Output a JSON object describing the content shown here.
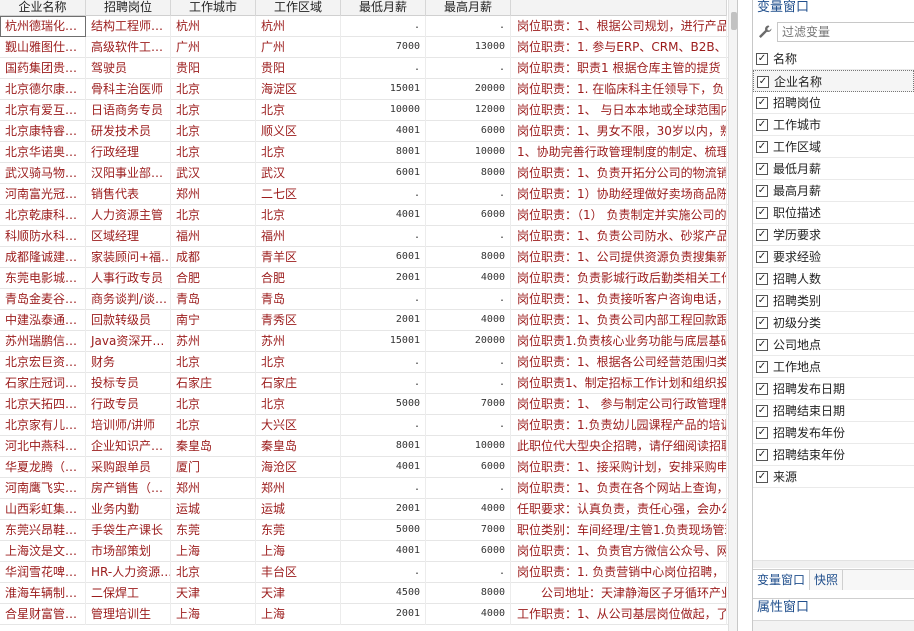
{
  "grid": {
    "columns": [
      "企业名称",
      "招聘岗位",
      "工作城市",
      "工作区域",
      "最低月薪",
      "最高月薪",
      ""
    ],
    "rows": [
      [
        "杭州德瑞化…",
        "结构工程师…",
        "杭州",
        "杭州",
        ".",
        ".",
        "岗位职责：1、根据公司规划，进行产品"
      ],
      [
        "觐山雅图仕…",
        "高级软件工…",
        "广州",
        "广州",
        "7000",
        "13000",
        "岗位职责：1. 参与ERP、CRM、B2B、BI、"
      ],
      [
        "国药集团贵…",
        "驾驶员",
        "贵阳",
        "贵阳",
        ".",
        ".",
        "岗位职责：职责1 根据仓库主管的提货"
      ],
      [
        "北京德尔康…",
        "骨科主治医师",
        "北京",
        "海淀区",
        "15001",
        "20000",
        "岗位职责：1. 在临床科主任领导下，负"
      ],
      [
        "北京有爱互…",
        "日语商务专员",
        "北京",
        "北京",
        "10000",
        "12000",
        "岗位职责：1、 与日本本地或全球范围内"
      ],
      [
        "北京康特睿…",
        "研发技术员",
        "北京",
        "顺义区",
        "4001",
        "6000",
        "岗位职责：1、男女不限，30岁以内，熟"
      ],
      [
        "北京华诺奥…",
        "行政经理",
        "北京",
        "北京",
        "8001",
        "10000",
        "1、协助完善行政管理制度的制定、梳理"
      ],
      [
        "武汉骑马物…",
        "汉阳事业部…",
        "武汉",
        "武汉",
        "6001",
        "8000",
        "岗位职责：1、负责开拓分公司的物流销"
      ],
      [
        "河南富光冠…",
        "销售代表",
        "郑州",
        "二七区",
        ".",
        ".",
        "岗位职责：1）协助经理做好卖场商品陈"
      ],
      [
        "北京乾康科…",
        "人力资源主管",
        "北京",
        "北京",
        "4001",
        "6000",
        "岗位职责：（1） 负责制定并实施公司的"
      ],
      [
        "科顺防水科…",
        "区域经理",
        "福州",
        "福州",
        ".",
        ".",
        "岗位职责：1、负责公司防水、砂浆产品"
      ],
      [
        "成都隆诚建…",
        "家装顾问+福…",
        "成都",
        "青羊区",
        "6001",
        "8000",
        "岗位职责：1、公司提供资源负责搜集新"
      ],
      [
        "东莞电影城…",
        "人事行政专员",
        "合肥",
        "合肥",
        "2001",
        "4000",
        "岗位职责：负责影城行政后勤类相关工作"
      ],
      [
        "青岛金麦谷…",
        "商务谈判/谈…",
        "青岛",
        "青岛",
        ".",
        ".",
        "岗位职责：1、负责接听客户咨询电话，"
      ],
      [
        "中建泓泰通…",
        "回款转级员",
        "南宁",
        "青秀区",
        "2001",
        "4000",
        "岗位职责：1、负责公司内部工程回款跟"
      ],
      [
        "苏州瑞鹏信…",
        "Java资深开…",
        "苏州",
        "苏州",
        "15001",
        "20000",
        "岗位职责1.负责核心业务功能与底层基础"
      ],
      [
        "北京宏巨资…",
        "财务",
        "北京",
        "北京",
        ".",
        ".",
        "岗位职责：1、根据各公司经营范围归类"
      ],
      [
        "石家庄冠词…",
        "投标专员",
        "石家庄",
        "石家庄",
        ".",
        ".",
        "岗位职责1、制定招标工作计划和组织投"
      ],
      [
        "北京天拓四…",
        "行政专员",
        "北京",
        "北京",
        "5000",
        "7000",
        "岗位职责：1、 参与制定公司行政管理制"
      ],
      [
        "北京家有儿…",
        "培训师/讲师",
        "北京",
        "大兴区",
        ".",
        ".",
        "岗位职责：1.负责幼儿园课程产品的培训"
      ],
      [
        "河北中燕科…",
        "企业知识产…",
        "秦皇岛",
        "秦皇岛",
        "8001",
        "10000",
        "此职位代大型央企招聘，请仔细阅读招聘"
      ],
      [
        "华夏龙腾（…",
        "采购跟单员",
        "厦门",
        "海沧区",
        "4001",
        "6000",
        "岗位职责：1、接采购计划，安排采购申"
      ],
      [
        "河南鹰飞实…",
        "房产销售（…",
        "郑州",
        "郑州",
        ".",
        ".",
        "岗位职责：1、负责在各个网站上查询，"
      ],
      [
        "山西彩虹集…",
        "业务内勤",
        "运城",
        "运城",
        "2001",
        "4000",
        "任职要求：认真负责，责任心强，会办公"
      ],
      [
        "东莞兴昂鞋…",
        "手袋生产课长",
        "东莞",
        "东莞",
        "5000",
        "7000",
        "职位类别：车间经理/主管1.负责现场管理"
      ],
      [
        "上海汶是文…",
        "市场部策划",
        "上海",
        "上海",
        "4001",
        "6000",
        "岗位职责：1、负责官方微信公众号、网"
      ],
      [
        "华润雪花啤…",
        "HR-人力资源…",
        "北京",
        "丰台区",
        ".",
        ".",
        "岗位职责：1. 负责营销中心岗位招聘，"
      ],
      [
        "淮海车辆制…",
        "二保焊工",
        "天津",
        "天津",
        "4500",
        "8000",
        "　　公司地址：天津静海区子牙循环产业"
      ],
      [
        "合星财富管…",
        "管理培训生",
        "上海",
        "上海",
        "2001",
        "4000",
        "工作职责：1、从公司基层岗位做起，了"
      ]
    ]
  },
  "panel": {
    "title": "变量窗口",
    "filter_placeholder": "过滤变量",
    "variables": [
      {
        "label": "名称",
        "checked": true
      },
      {
        "label": "企业名称",
        "checked": true,
        "active": true
      },
      {
        "label": "招聘岗位",
        "checked": true
      },
      {
        "label": "工作城市",
        "checked": true
      },
      {
        "label": "工作区域",
        "checked": true
      },
      {
        "label": "最低月薪",
        "checked": true
      },
      {
        "label": "最高月薪",
        "checked": true
      },
      {
        "label": "职位描述",
        "checked": true
      },
      {
        "label": "学历要求",
        "checked": true
      },
      {
        "label": "要求经验",
        "checked": true
      },
      {
        "label": "招聘人数",
        "checked": true
      },
      {
        "label": "招聘类别",
        "checked": true
      },
      {
        "label": "初级分类",
        "checked": true
      },
      {
        "label": "公司地点",
        "checked": true
      },
      {
        "label": "工作地点",
        "checked": true
      },
      {
        "label": "招聘发布日期",
        "checked": true
      },
      {
        "label": "招聘结束日期",
        "checked": true
      },
      {
        "label": "招聘发布年份",
        "checked": true
      },
      {
        "label": "招聘结束年份",
        "checked": true
      },
      {
        "label": "来源",
        "checked": true
      }
    ],
    "tabs": [
      "变量窗口",
      "快照"
    ],
    "props_title": "属性窗口"
  },
  "colors": {
    "data_text": "#9b1b1b",
    "panel_title": "#1f4e8c"
  },
  "icons": {
    "filter": "wrench-icon",
    "check": "checkmark-icon"
  }
}
